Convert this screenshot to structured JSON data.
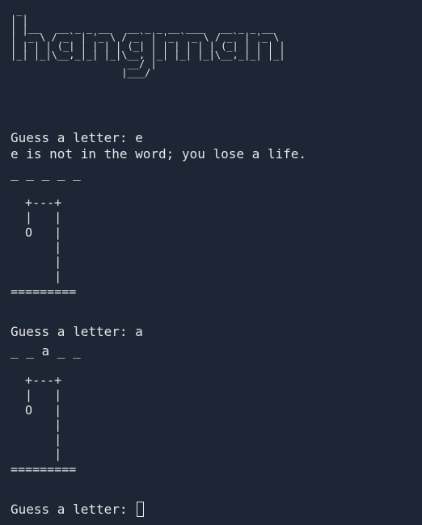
{
  "logo_art": " _\n| |\n| |__   __ _ _ __   __ _ _ __ ___   __ _ _ __\n| '_ \\ / _` | '_ \\ / _` | '_ ` _ \\ / _` | '_ \\\n| | | | (_| | | | | (_| | | | | | | (_| | | | |\n|_| |_|\\__,_|_| |_|\\__, |_| |_| |_|\\__,_|_| |_|\n                    __/ |\n                   |___/",
  "turn1": {
    "prompt": "Guess a letter: e",
    "message": "e is not in the word; you lose a life.",
    "word": "_ _ _ _ _",
    "gallows": "  +---+\n  |   |\n  O   |\n      |\n      |\n      |\n========="
  },
  "turn2": {
    "prompt": "Guess a letter: a",
    "word": "_ _ a _ _",
    "gallows": "  +---+\n  |   |\n  O   |\n      |\n      |\n      |\n========="
  },
  "current_prompt": "Guess a letter: "
}
